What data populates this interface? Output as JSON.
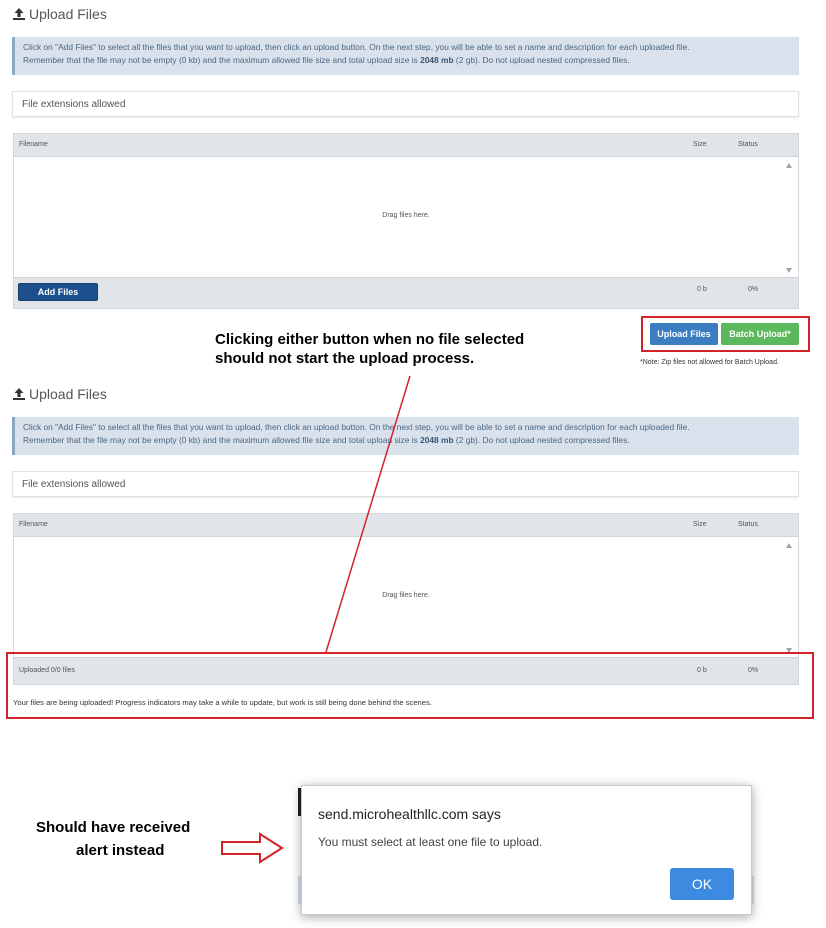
{
  "panel1": {
    "title": "Upload Files",
    "info_line1": "Click on \"Add Files\" to select all the files that you want to upload, then click an upload button. On the next step, you will be able to set a name and description for each uploaded file.",
    "info_line2_a": "Remember that the file may not be empty (0 kb) and the maximum allowed file size and total upload size is ",
    "info_line2_bold": "2048 mb",
    "info_line2_b": " (2 gb). Do not upload nested compressed files.",
    "extensions_label": "File extensions allowed",
    "col_filename": "Filename",
    "col_size": "Size",
    "col_status": "Status",
    "drag_text": "Drag files here.",
    "add_files_label": "Add Files",
    "total_size": "0 b",
    "total_percent": "0%",
    "upload_files_label": "Upload Files",
    "batch_upload_label": "Batch Upload*",
    "note": "*Note: Zip files not allowed for Batch Upload."
  },
  "panel2": {
    "title": "Upload Files",
    "info_line1": "Click on \"Add Files\" to select all the files that you want to upload, then click an upload button. On the next step, you will be able to set a name and description for each uploaded file.",
    "info_line2_a": "Remember that the file may not be empty (0 kb) and the maximum allowed file size and total upload size is ",
    "info_line2_bold": "2048 mb",
    "info_line2_b": " (2 gb). Do not upload nested compressed files.",
    "extensions_label": "File extensions allowed",
    "col_filename": "Filename",
    "col_size": "Size",
    "col_status": "Status",
    "drag_text": "Drag files here.",
    "uploaded_status": "Uploaded 0/0 files",
    "total_size": "0 b",
    "total_percent": "0%",
    "progress_message": "Your files are being uploaded! Progress indicators may take a while to update, but work is still being done behind the scenes."
  },
  "annotations": {
    "callout_line1": "Clicking either button when no file selected",
    "callout_line2": "should not start the upload process.",
    "expected_line1": "Should have received",
    "expected_line2": "alert  instead",
    "annotation_color": "#d2232a"
  },
  "dialog": {
    "origin": "send.microhealthllc.com says",
    "message": "You must select at least one file to upload.",
    "ok_label": "OK"
  },
  "icons": {
    "upload": "upload-icon",
    "arrow": "right-arrow-outline-icon"
  }
}
